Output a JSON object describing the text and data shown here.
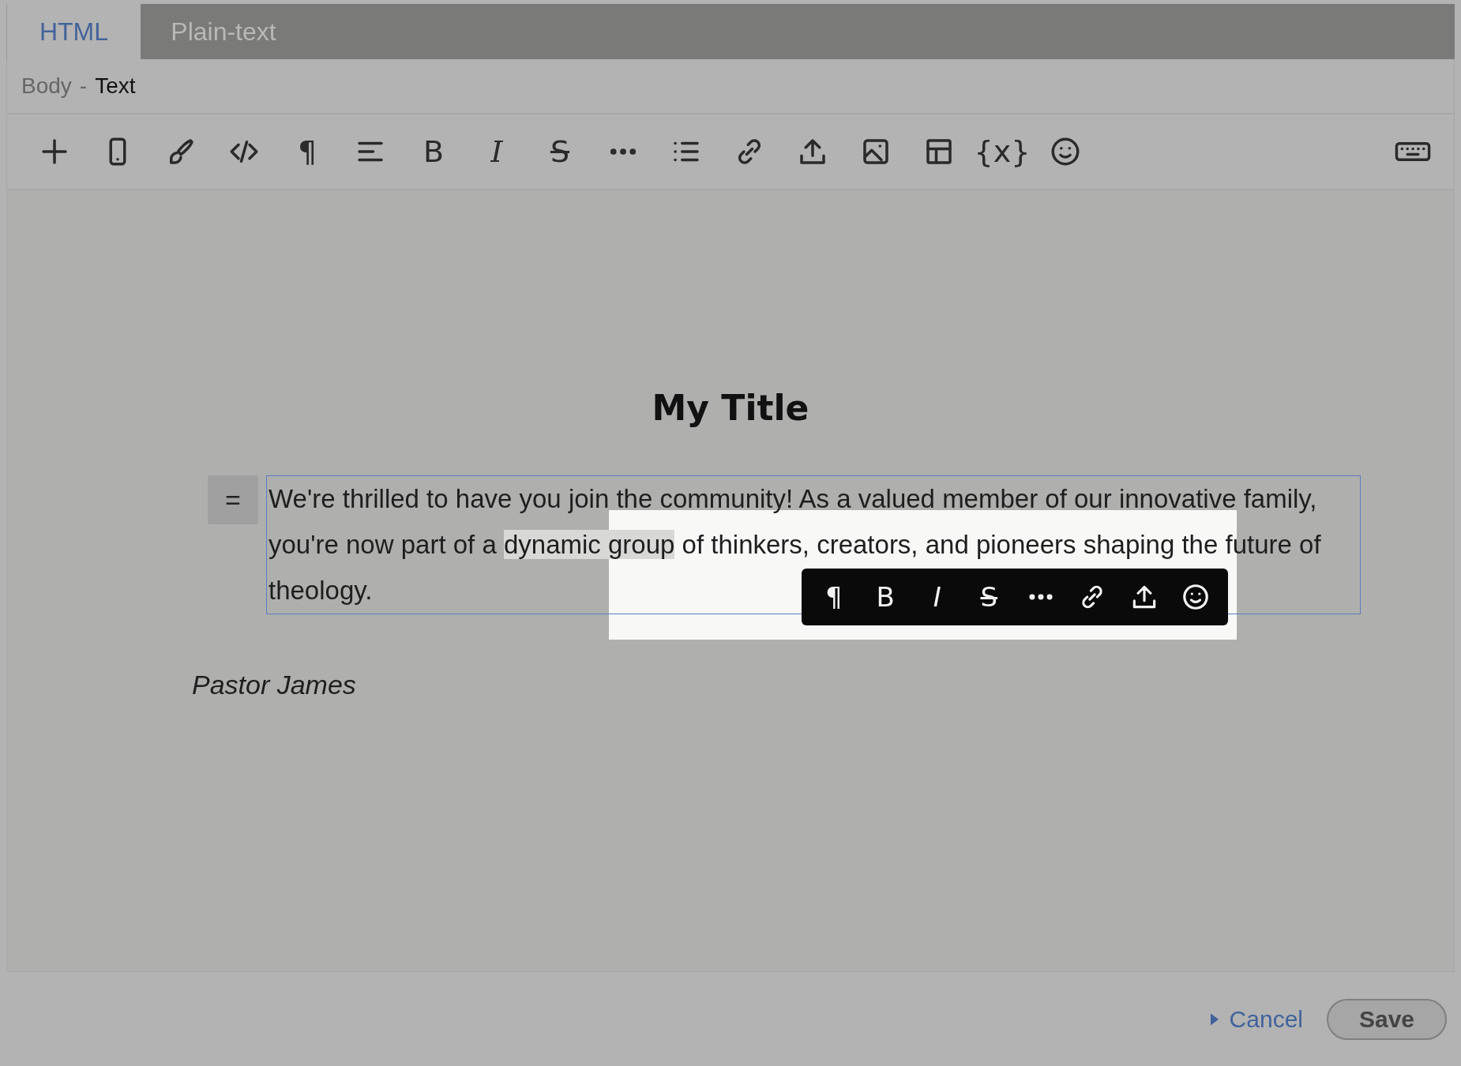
{
  "tabs": [
    {
      "label": "HTML",
      "selected": true
    },
    {
      "label": "Plain-text",
      "selected": false
    }
  ],
  "breadcrumb": {
    "section": "Body",
    "separator": "-",
    "current": "Text"
  },
  "toolbar": [
    {
      "kind": "plus"
    },
    {
      "kind": "mobile"
    },
    {
      "kind": "brush"
    },
    {
      "kind": "code"
    },
    {
      "kind": "glyph",
      "text": "¶"
    },
    {
      "kind": "align"
    },
    {
      "kind": "bold",
      "text": "B"
    },
    {
      "kind": "italic",
      "text": "I"
    },
    {
      "kind": "strike",
      "text": "S"
    },
    {
      "kind": "more"
    },
    {
      "kind": "list"
    },
    {
      "kind": "link"
    },
    {
      "kind": "upload"
    },
    {
      "kind": "image"
    },
    {
      "kind": "table"
    },
    {
      "kind": "glyph",
      "text": "{x}"
    },
    {
      "kind": "emoji"
    }
  ],
  "document": {
    "title": "My Title",
    "paragraph": [
      {
        "text": "We're thrilled to have you join the community! As a valued member of our innovative family, you're now part of a ",
        "selected": false
      },
      {
        "text": "dynamic group",
        "selected": true
      },
      {
        "text": " of thinkers, creators, and pioneers shaping the future of theology.",
        "selected": false
      }
    ],
    "handle": "=",
    "signature": "Pastor James"
  },
  "floating_toolbar": [
    {
      "kind": "glyph",
      "text": "¶"
    },
    {
      "kind": "bold",
      "text": "B"
    },
    {
      "kind": "italic",
      "text": "I"
    },
    {
      "kind": "strike",
      "text": "S"
    },
    {
      "kind": "more"
    },
    {
      "kind": "link"
    },
    {
      "kind": "upload"
    },
    {
      "kind": "emoji"
    }
  ],
  "footer": {
    "cancel": "Cancel",
    "save": "Save"
  }
}
